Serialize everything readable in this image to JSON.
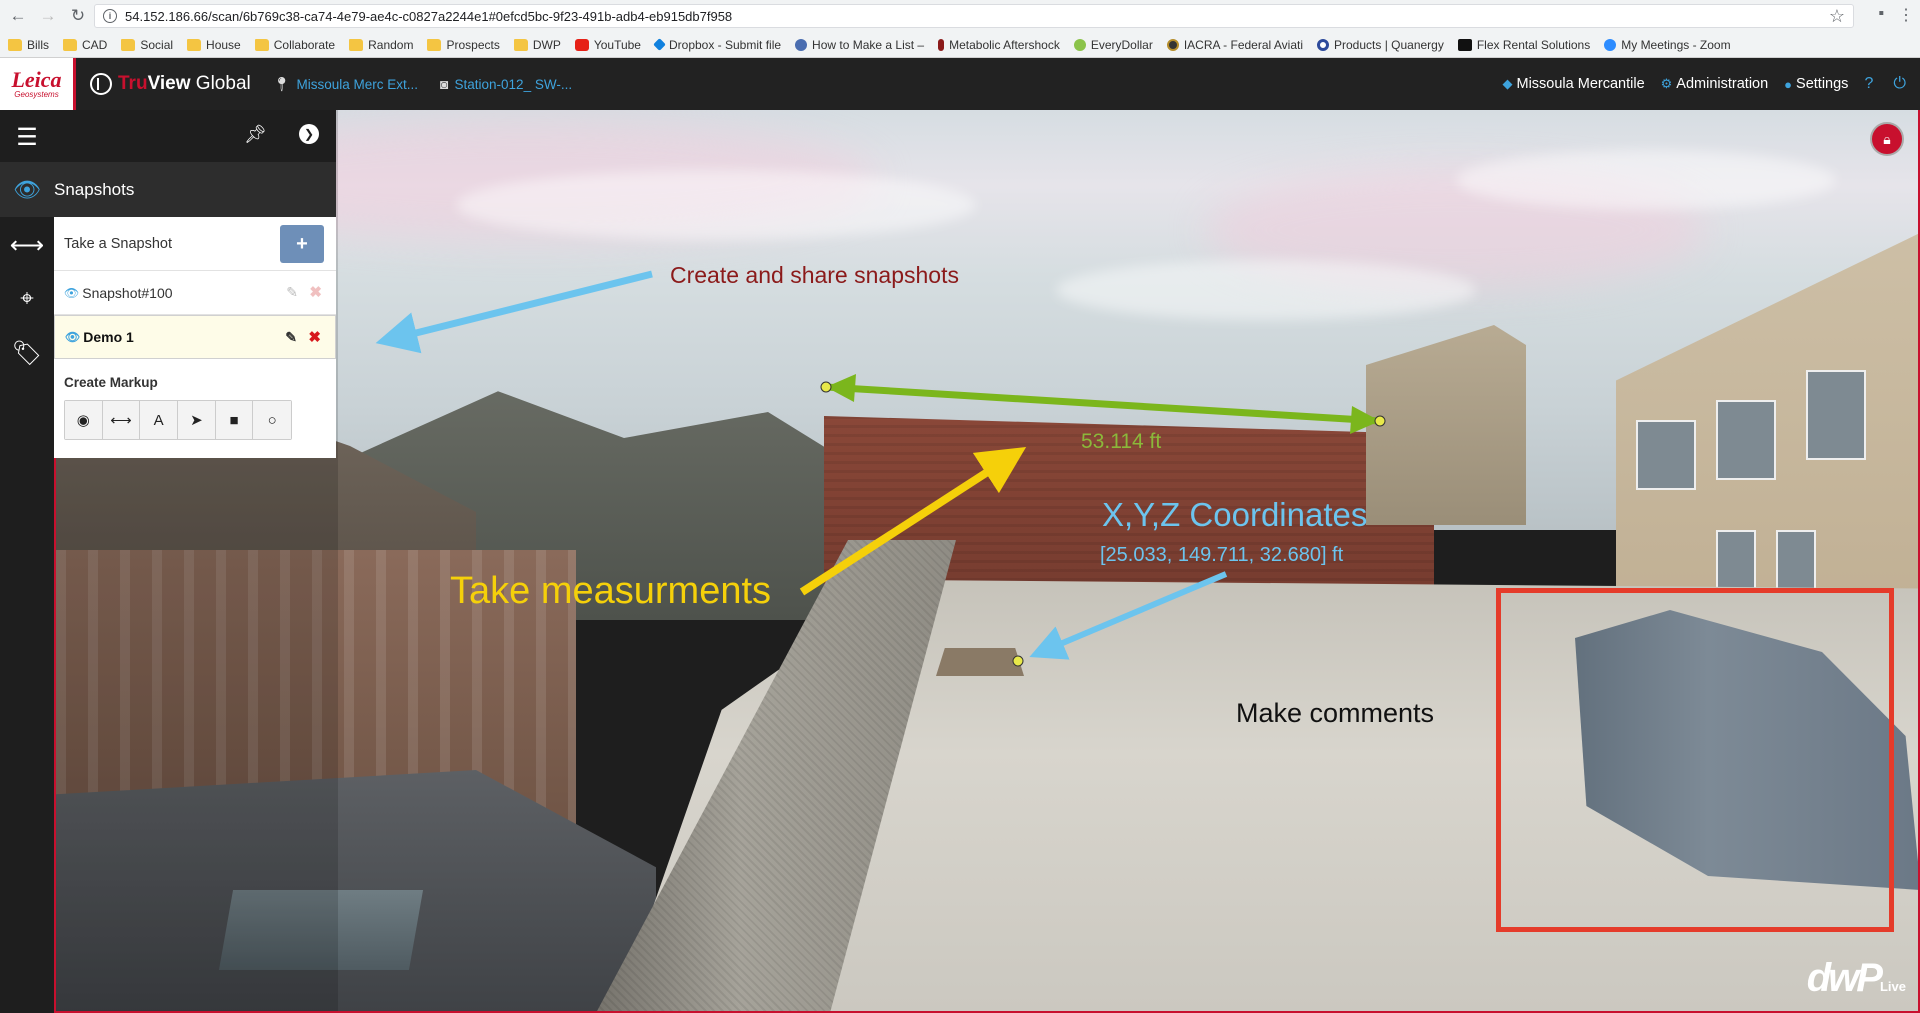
{
  "browser": {
    "url": "54.152.186.66/scan/6b769c38-ca74-4e79-ae4c-c0827a2244e1#0efcd5bc-9f23-491b-adb4-eb915db7f958",
    "bookmarks": [
      {
        "label": "Bills",
        "icon": "folder-icon"
      },
      {
        "label": "CAD",
        "icon": "folder-icon"
      },
      {
        "label": "Social",
        "icon": "folder-icon"
      },
      {
        "label": "House",
        "icon": "folder-icon"
      },
      {
        "label": "Collaborate",
        "icon": "folder-icon"
      },
      {
        "label": "Random",
        "icon": "folder-icon"
      },
      {
        "label": "Prospects",
        "icon": "folder-icon"
      },
      {
        "label": "DWP",
        "icon": "folder-icon"
      },
      {
        "label": "YouTube",
        "icon": "youtube-icon"
      },
      {
        "label": "Dropbox - Submit file",
        "icon": "dropbox-icon"
      },
      {
        "label": "How to Make a List –",
        "icon": "globe-icon"
      },
      {
        "label": "Metabolic Aftershock",
        "icon": "figure-icon"
      },
      {
        "label": "EveryDollar",
        "icon": "everydollar-icon"
      },
      {
        "label": "IACRA - Federal Aviati",
        "icon": "seal-icon"
      },
      {
        "label": "Products | Quanergy",
        "icon": "quanergy-icon"
      },
      {
        "label": "Flex Rental Solutions",
        "icon": "flex-icon"
      },
      {
        "label": "My Meetings - Zoom",
        "icon": "zoom-icon"
      }
    ]
  },
  "header": {
    "logo_brand": "Leica",
    "logo_sub": "Geosystems",
    "app_name_tru": "Tru",
    "app_name_view": "View",
    "app_name_global": " Global",
    "breadcrumb_site": "Missoula Merc Ext...",
    "breadcrumb_station": "Station-012_ SW-...",
    "project": "Missoula Mercantile",
    "administration": "Administration",
    "settings": "Settings"
  },
  "sidebar": {
    "section_title": "Snapshots",
    "take_snapshot": "Take a Snapshot",
    "add_label": "+",
    "snapshots": [
      {
        "name": "Snapshot#100",
        "active": false
      },
      {
        "name": "Demo 1",
        "active": true
      }
    ],
    "markup_title": "Create Markup",
    "markup_tools": [
      {
        "name": "target-icon",
        "glyph": "◉"
      },
      {
        "name": "measure-icon",
        "glyph": "⟷"
      },
      {
        "name": "text-icon",
        "glyph": "A"
      },
      {
        "name": "arrow-icon",
        "glyph": "➤"
      },
      {
        "name": "rectangle-icon",
        "glyph": "■"
      },
      {
        "name": "circle-icon",
        "glyph": "○"
      }
    ]
  },
  "annotations": {
    "snapshots_note": "Create and share snapshots",
    "measure_value": "53.114 ft",
    "xyz_title": "X,Y,Z Coordinates",
    "xyz_value": "[25.033, 149.711, 32.680] ft",
    "measure_note": "Take measurments",
    "comments_note": "Make comments"
  },
  "watermark": {
    "text": "dwP",
    "sub": "Live"
  },
  "colors": {
    "brand_red": "#c8102e",
    "link_blue": "#3ea3dd",
    "measure_green": "#7bb61c",
    "xyz_blue": "#6cc4ee",
    "measure_yellow": "#f5d00a",
    "comment_red": "#e53b2a"
  }
}
